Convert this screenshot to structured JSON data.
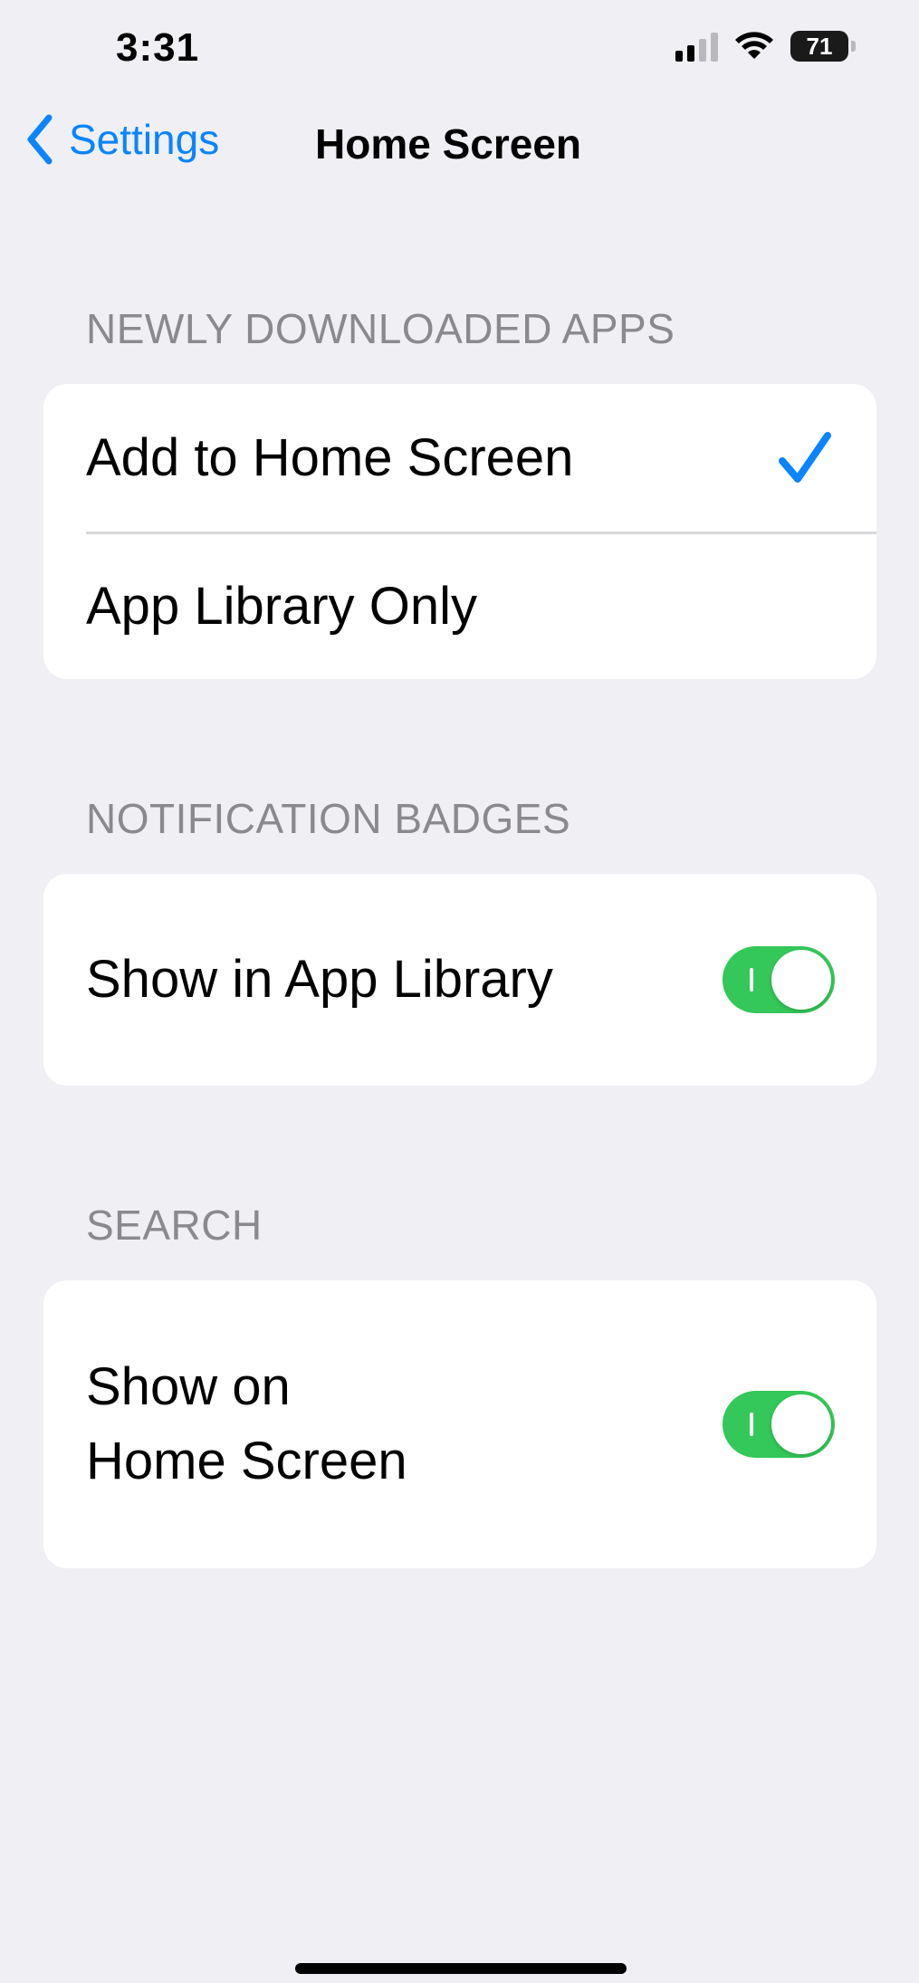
{
  "status_bar": {
    "time": "3:31",
    "battery": "71",
    "signal_bars_active": 2,
    "signal_bars_total": 4
  },
  "nav": {
    "back_label": "Settings",
    "title": "Home Screen"
  },
  "sections": {
    "newly_downloaded": {
      "header": "NEWLY DOWNLOADED APPS",
      "options": [
        {
          "label": "Add to Home Screen",
          "selected": true
        },
        {
          "label": "App Library Only",
          "selected": false
        }
      ]
    },
    "notification_badges": {
      "header": "NOTIFICATION BADGES",
      "label": "Show in App Library",
      "enabled": true
    },
    "search": {
      "header": "SEARCH",
      "label_line1": "Show on",
      "label_line2": "Home Screen",
      "enabled": true
    }
  },
  "colors": {
    "accent": "#0a84ff",
    "toggle_on": "#34c759",
    "background": "#efeff4",
    "header_text": "#8a8a8e"
  },
  "icons": {
    "back": "chevron-left-icon",
    "check": "checkmark-icon",
    "wifi": "wifi-icon",
    "signal": "signal-icon",
    "battery": "battery-icon"
  }
}
